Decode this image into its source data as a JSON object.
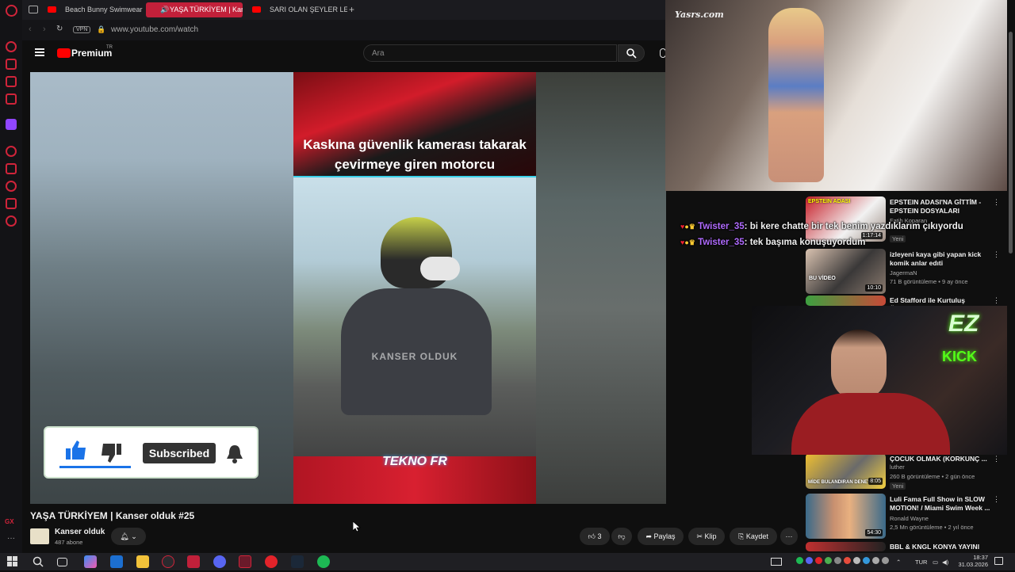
{
  "browser": {
    "tabs": [
      {
        "label": "Beach Bunny Swimwear Fu"
      },
      {
        "label": "YAŞA TÜRKİYEM | Kan"
      },
      {
        "label": "SARI OLAN ŞEYLER LEZZE"
      }
    ],
    "url": "www.youtube.com/watch",
    "vpn_label": "VPN"
  },
  "youtube": {
    "logo_text": "Premium",
    "logo_sup": "TR",
    "search_placeholder": "Ara"
  },
  "video": {
    "caption": "Kaskına güvenlik kamerası takarak çevirmeye giren motorcu",
    "watermark": "KANSER OLDUK",
    "brand_overlay": "TEKNO FR",
    "subscribed_label": "Subscribed"
  },
  "meta": {
    "title": "YAŞA TÜRKİYEM | Kanser olduk #25",
    "channel_name": "Kanser olduk",
    "subscribers": "487 abone",
    "like_count": "3",
    "share_label": "Paylaş",
    "clip_label": "Klip",
    "save_label": "Kaydet"
  },
  "overlay": {
    "runway_watermark": "Yasrs.com",
    "webcam_sign_1": "EZ",
    "webcam_sign_2": "KICK",
    "chat": [
      {
        "user": "Twister_35",
        "message": ": bi kere chatte bir tek benim yazdıklarım çıkıyordu"
      },
      {
        "user": "Twister_35",
        "message": ": tek başıma konuşuyordum"
      }
    ]
  },
  "recommendations": [
    {
      "title": "EPSTEIN ADASI'NA GİTTİM - EPSTEIN DOSYALARI",
      "channel": "Fatih Koparan",
      "stats": "",
      "badge": "Yeni",
      "duration": "1:17:14",
      "thumb_text": "EPSTEIN ADASI"
    },
    {
      "title": "izleyeni kaya gibi yapan kick komik anlar edıti",
      "channel": "JagermaN",
      "stats": "71 B görüntüleme • 9 ay önce",
      "badge": "",
      "duration": "10:10",
      "thumb_text": "BU VİDEO"
    },
    {
      "title": "Ed Stafford ile Kurtuluş Öyküleri",
      "channel": "",
      "stats": "",
      "badge": "",
      "duration": "",
      "thumb_text": ""
    },
    {
      "title": "ÇOCUK OLMAK (KORKUNÇ ...",
      "channel": "luther",
      "stats": "260 B görüntüleme • 2 gün önce",
      "badge": "Yeni",
      "duration": "8:05",
      "thumb_text": "MİDE BULANDIRAN DENEY"
    },
    {
      "title": "Luli Fama Full Show in SLOW MOTION! / Miami Swim Week ...",
      "channel": "Ronald Wayne",
      "stats": "2,5 Mn görüntüleme • 2 yıl önce",
      "badge": "",
      "duration": "54:30",
      "thumb_text": ""
    },
    {
      "title": "BBL & KNGL KONYA YAYINI",
      "channel": "",
      "stats": "",
      "badge": "",
      "duration": "",
      "thumb_text": ""
    }
  ],
  "taskbar": {
    "lang": "TUR",
    "time": "18:37",
    "date": "31.03.2026"
  },
  "colors": {
    "opera_red": "#d0243a",
    "yt_red": "#ff0000",
    "chat_name": "#b06bff",
    "kick_green": "#53fc18"
  }
}
